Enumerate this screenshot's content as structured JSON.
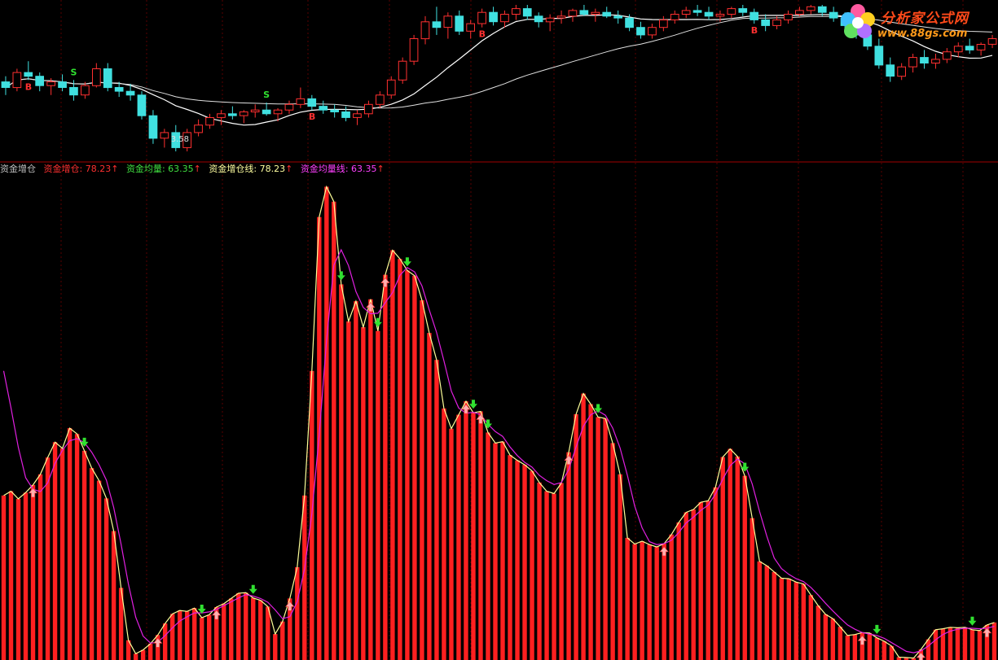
{
  "indicator_title": "资金增仓",
  "legend": [
    {
      "label": "资金增仓",
      "value": "78.23",
      "arrow": "↑",
      "color": "#ff3030"
    },
    {
      "label": "资金均量",
      "value": "63.35",
      "arrow": "↑",
      "color": "#40e040"
    },
    {
      "label": "资金增仓线",
      "value": "78.23",
      "arrow": "↑",
      "color": "#ffffa0"
    },
    {
      "label": "资金均量线",
      "value": "63.35",
      "arrow": "↑",
      "color": "#ff40ff"
    }
  ],
  "logo": {
    "title": "分析家公式网",
    "url": "www.88gs.com"
  },
  "price_annotations": {
    "low_label": "3.58",
    "buy_marker": "B",
    "sell_marker": "S"
  },
  "colors": {
    "bar": "#ff2020",
    "avg_line": "#e020e0",
    "zengcang_line": "#ffff99",
    "up_candle": "#ff3030",
    "down_candle": "#40e0e0",
    "ma_line": "#ffffff",
    "grid": "#5a0000",
    "separator": "#a00000"
  },
  "chart_data": [
    {
      "type": "candlestick",
      "title": "",
      "values": [
        [
          3.95,
          3.98,
          3.88,
          3.92
        ],
        [
          3.92,
          4.02,
          3.9,
          4.0
        ],
        [
          4.0,
          4.06,
          3.96,
          3.98
        ],
        [
          3.98,
          4.0,
          3.9,
          3.93
        ],
        [
          3.93,
          3.97,
          3.88,
          3.95
        ],
        [
          3.95,
          3.99,
          3.9,
          3.92
        ],
        [
          3.92,
          3.96,
          3.85,
          3.88
        ],
        [
          3.88,
          3.95,
          3.86,
          3.93
        ],
        [
          3.93,
          4.05,
          3.92,
          4.02
        ],
        [
          4.02,
          4.05,
          3.9,
          3.92
        ],
        [
          3.92,
          3.95,
          3.87,
          3.9
        ],
        [
          3.9,
          3.94,
          3.85,
          3.88
        ],
        [
          3.88,
          3.9,
          3.75,
          3.77
        ],
        [
          3.77,
          3.8,
          3.62,
          3.65
        ],
        [
          3.65,
          3.7,
          3.6,
          3.68
        ],
        [
          3.68,
          3.72,
          3.58,
          3.6
        ],
        [
          3.6,
          3.7,
          3.58,
          3.68
        ],
        [
          3.68,
          3.75,
          3.66,
          3.72
        ],
        [
          3.72,
          3.78,
          3.7,
          3.76
        ],
        [
          3.76,
          3.8,
          3.72,
          3.78
        ],
        [
          3.78,
          3.82,
          3.75,
          3.77
        ],
        [
          3.77,
          3.8,
          3.73,
          3.79
        ],
        [
          3.79,
          3.83,
          3.76,
          3.8
        ],
        [
          3.8,
          3.84,
          3.77,
          3.78
        ],
        [
          3.78,
          3.81,
          3.74,
          3.8
        ],
        [
          3.8,
          3.85,
          3.78,
          3.83
        ],
        [
          3.83,
          3.92,
          3.81,
          3.86
        ],
        [
          3.86,
          3.88,
          3.8,
          3.82
        ],
        [
          3.82,
          3.85,
          3.78,
          3.8
        ],
        [
          3.8,
          3.83,
          3.76,
          3.79
        ],
        [
          3.79,
          3.82,
          3.74,
          3.76
        ],
        [
          3.76,
          3.8,
          3.72,
          3.78
        ],
        [
          3.78,
          3.85,
          3.76,
          3.83
        ],
        [
          3.83,
          3.9,
          3.81,
          3.88
        ],
        [
          3.88,
          3.98,
          3.86,
          3.96
        ],
        [
          3.96,
          4.08,
          3.94,
          4.06
        ],
        [
          4.06,
          4.2,
          4.04,
          4.18
        ],
        [
          4.18,
          4.3,
          4.15,
          4.27
        ],
        [
          4.27,
          4.35,
          4.2,
          4.24
        ],
        [
          4.24,
          4.32,
          4.18,
          4.3
        ],
        [
          4.3,
          4.33,
          4.2,
          4.22
        ],
        [
          4.22,
          4.28,
          4.18,
          4.26
        ],
        [
          4.26,
          4.34,
          4.24,
          4.32
        ],
        [
          4.32,
          4.35,
          4.25,
          4.27
        ],
        [
          4.27,
          4.33,
          4.24,
          4.31
        ],
        [
          4.31,
          4.36,
          4.28,
          4.34
        ],
        [
          4.34,
          4.36,
          4.28,
          4.3
        ],
        [
          4.3,
          4.32,
          4.24,
          4.27
        ],
        [
          4.27,
          4.31,
          4.22,
          4.29
        ],
        [
          4.29,
          4.33,
          4.26,
          4.3
        ],
        [
          4.3,
          4.34,
          4.27,
          4.33
        ],
        [
          4.33,
          4.36,
          4.3,
          4.31
        ],
        [
          4.31,
          4.34,
          4.27,
          4.32
        ],
        [
          4.32,
          4.35,
          4.29,
          4.3
        ],
        [
          4.3,
          4.33,
          4.26,
          4.29
        ],
        [
          4.29,
          4.31,
          4.22,
          4.24
        ],
        [
          4.24,
          4.27,
          4.18,
          4.2
        ],
        [
          4.2,
          4.26,
          4.18,
          4.24
        ],
        [
          4.24,
          4.3,
          4.22,
          4.28
        ],
        [
          4.28,
          4.33,
          4.26,
          4.31
        ],
        [
          4.31,
          4.35,
          4.29,
          4.33
        ],
        [
          4.33,
          4.36,
          4.3,
          4.32
        ],
        [
          4.32,
          4.35,
          4.28,
          4.3
        ],
        [
          4.3,
          4.33,
          4.27,
          4.31
        ],
        [
          4.31,
          4.35,
          4.29,
          4.34
        ],
        [
          4.34,
          4.36,
          4.3,
          4.32
        ],
        [
          4.32,
          4.34,
          4.26,
          4.28
        ],
        [
          4.28,
          4.31,
          4.22,
          4.25
        ],
        [
          4.25,
          4.3,
          4.23,
          4.28
        ],
        [
          4.28,
          4.33,
          4.26,
          4.31
        ],
        [
          4.31,
          4.35,
          4.3,
          4.33
        ],
        [
          4.33,
          4.36,
          4.31,
          4.35
        ],
        [
          4.35,
          4.36,
          4.3,
          4.32
        ],
        [
          4.32,
          4.35,
          4.27,
          4.29
        ],
        [
          4.29,
          4.32,
          4.23,
          4.25
        ],
        [
          4.25,
          4.28,
          4.18,
          4.2
        ],
        [
          4.2,
          4.23,
          4.12,
          4.14
        ],
        [
          4.14,
          4.18,
          4.02,
          4.04
        ],
        [
          4.04,
          4.08,
          3.95,
          3.98
        ],
        [
          3.98,
          4.05,
          3.96,
          4.03
        ],
        [
          4.03,
          4.1,
          4.0,
          4.08
        ],
        [
          4.08,
          4.12,
          4.02,
          4.05
        ],
        [
          4.05,
          4.1,
          4.02,
          4.07
        ],
        [
          4.07,
          4.13,
          4.05,
          4.11
        ],
        [
          4.11,
          4.16,
          4.08,
          4.14
        ],
        [
          4.14,
          4.18,
          4.1,
          4.12
        ],
        [
          4.12,
          4.16,
          4.09,
          4.15
        ],
        [
          4.15,
          4.2,
          4.13,
          4.18
        ]
      ]
    },
    {
      "type": "bar",
      "title": "资金增仓",
      "ylim": [
        0,
        100
      ],
      "series": [
        {
          "name": "资金增仓",
          "values": [
            34.2,
            35.1,
            33.5,
            34.8,
            36.4,
            38.6,
            42.1,
            45.3,
            44.0,
            48.2,
            47.0,
            43.5,
            39.9,
            37.3,
            33.6,
            26.8,
            15.0,
            4.1,
            1.3,
            2.1,
            3.4,
            5.2,
            7.6,
            9.6,
            10.3,
            10.1,
            10.8,
            8.8,
            9.4,
            11.0,
            11.7,
            12.8,
            13.9,
            14.0,
            12.9,
            12.4,
            11.1,
            5.4,
            8.0,
            12.8,
            19.3,
            34.2,
            60.1,
            92.1,
            98.4,
            95.3,
            78.1,
            70.4,
            74.6,
            69.2,
            75.0,
            68.4,
            80.1,
            85.2,
            83.4,
            81.0,
            79.9,
            74.8,
            68.0,
            62.4,
            52.3,
            48.1,
            51.0,
            53.8,
            51.4,
            51.7,
            47.3,
            45.1,
            45.4,
            42.6,
            41.5,
            40.6,
            39.3,
            36.9,
            35.1,
            34.6,
            36.8,
            43.2,
            51.1,
            55.4,
            53.2,
            50.5,
            50.2,
            45.1,
            38.6,
            25.4,
            24.1,
            24.7,
            24.0,
            23.5,
            24.2,
            26.1,
            28.6,
            30.7,
            31.3,
            32.8,
            33.1,
            35.9,
            42.2,
            43.9,
            42.3,
            38.3,
            29.5,
            20.5,
            19.6,
            18.3,
            17.0,
            16.9,
            16.2,
            15.8,
            13.5,
            11.3,
            9.5,
            8.6,
            6.9,
            5.1,
            5.3,
            5.7,
            5.6,
            4.6,
            3.9,
            2.9,
            0.6,
            0.5,
            0.4,
            2.2,
            4.3,
            6.3,
            6.5,
            6.8,
            6.7,
            6.8,
            6.3,
            6.1,
            7.3,
            7.8
          ]
        }
      ]
    },
    {
      "type": "line",
      "title": "资金均量线",
      "ylim": [
        0,
        100
      ],
      "series": [
        {
          "name": "资金均量线",
          "values": [
            60.1,
            52.4,
            44.2,
            37.9,
            35.5,
            35.0,
            36.8,
            40.9,
            43.6,
            45.6,
            46.0,
            45.2,
            43.2,
            40.6,
            37.4,
            31.7,
            24.1,
            15.8,
            8.9,
            5.0,
            3.5,
            3.7,
            5.1,
            6.7,
            8.1,
            9.0,
            9.8,
            9.8,
            10.0,
            10.5,
            11.3,
            12.1,
            12.9,
            13.6,
            13.3,
            12.8,
            12.0,
            10.4,
            8.6,
            9.0,
            12.1,
            18.9,
            30.4,
            46.8,
            66.4,
            82.1,
            85.3,
            82.0,
            76.6,
            73.3,
            72.0,
            72.1,
            74.3,
            76.4,
            80.0,
            81.6,
            80.7,
            77.8,
            72.8,
            68.1,
            62.2,
            55.9,
            52.4,
            51.3,
            51.5,
            51.0,
            49.0,
            47.5,
            46.5,
            44.3,
            42.5,
            41.1,
            40.1,
            38.4,
            37.3,
            36.5,
            36.9,
            39.6,
            44.3,
            48.6,
            51.0,
            51.8,
            50.9,
            48.2,
            44.1,
            38.4,
            32.0,
            27.5,
            24.6,
            24.0,
            24.2,
            24.9,
            26.5,
            28.5,
            29.7,
            31.1,
            32.2,
            34.5,
            37.6,
            40.4,
            41.8,
            40.8,
            36.6,
            30.9,
            25.7,
            21.2,
            19.0,
            17.8,
            16.9,
            16.3,
            15.1,
            13.5,
            11.8,
            10.2,
            8.7,
            7.3,
            6.4,
            5.7,
            5.4,
            5.1,
            4.5,
            3.6,
            2.7,
            1.8,
            1.5,
            1.9,
            2.9,
            4.2,
            5.3,
            6.0,
            6.4,
            6.6,
            6.6,
            6.5,
            6.6,
            7.0
          ]
        }
      ]
    }
  ]
}
